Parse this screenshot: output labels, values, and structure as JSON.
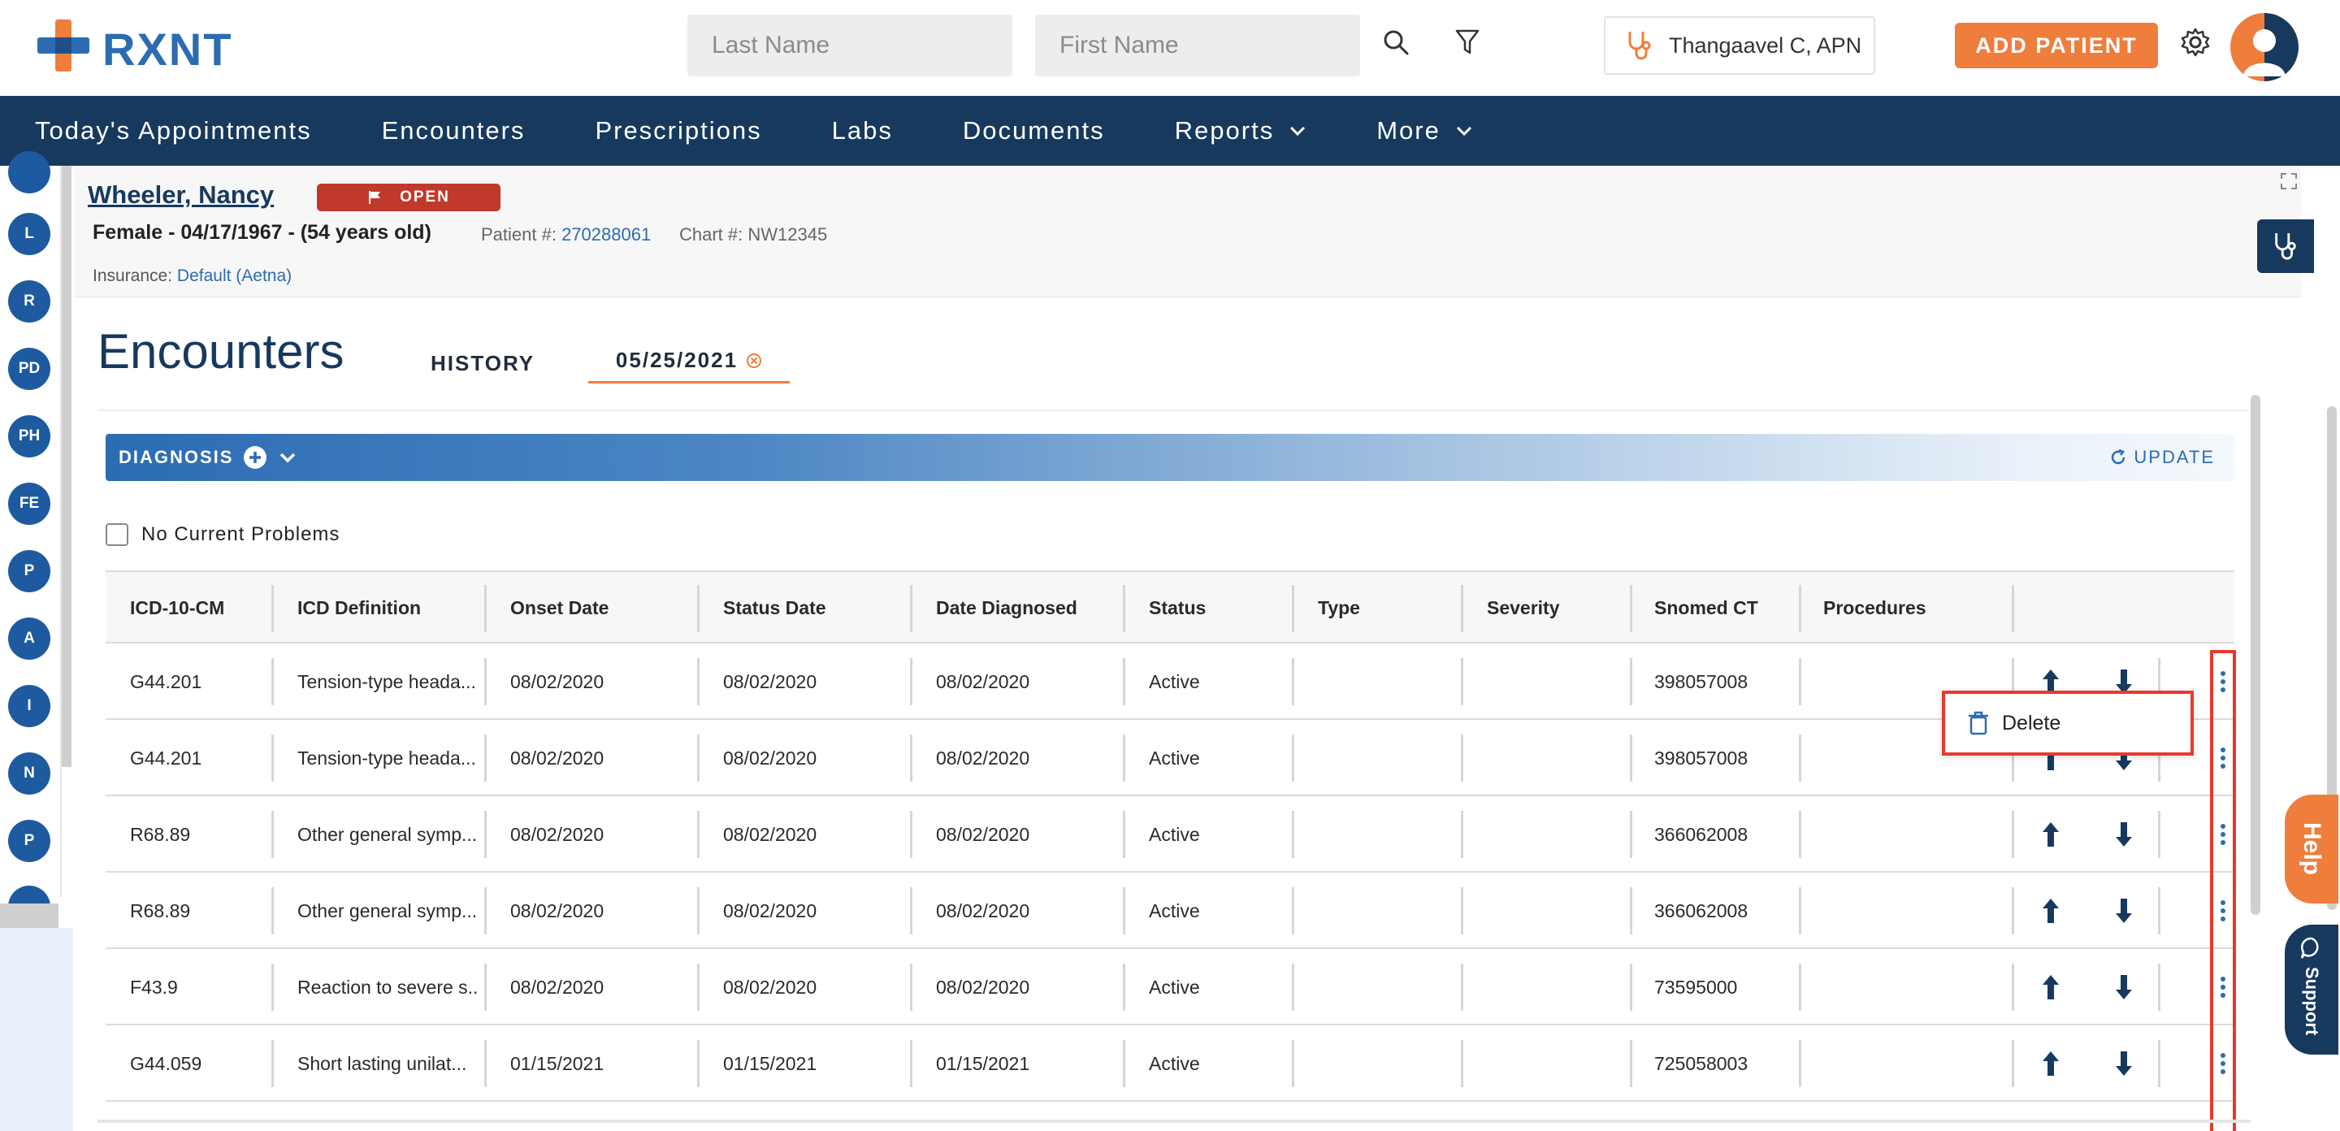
{
  "brand": {
    "logo_text": "RXNT"
  },
  "header": {
    "last_name_placeholder": "Last Name",
    "first_name_placeholder": "First Name",
    "provider_name": "Thangaavel C, APN",
    "add_patient_label": "ADD PATIENT"
  },
  "nav": {
    "items": [
      {
        "label": "Today's Appointments"
      },
      {
        "label": "Encounters"
      },
      {
        "label": "Prescriptions"
      },
      {
        "label": "Labs"
      },
      {
        "label": "Documents"
      },
      {
        "label": "Reports"
      },
      {
        "label": "More"
      }
    ]
  },
  "left_rail": {
    "items": [
      "L",
      "R",
      "PD",
      "PH",
      "FE",
      "P",
      "A",
      "I",
      "N",
      "P"
    ]
  },
  "patient": {
    "name": "Wheeler, Nancy",
    "status_badge": "OPEN",
    "demographics": "Female - 04/17/1967 - (54 years old)",
    "patient_num_label": "Patient #:",
    "patient_num": "270288061",
    "chart_label": "Chart #:",
    "chart_num": "NW12345",
    "insurance_label": "Insurance:",
    "insurance_value": "Default (Aetna)"
  },
  "encounters": {
    "title": "Encounters",
    "tab_history": "HISTORY",
    "tab_date": "05/25/2021"
  },
  "diagnosis": {
    "label": "DIAGNOSIS",
    "update_label": "UPDATE",
    "no_current_problems": "No Current Problems",
    "columns": [
      "ICD-10-CM",
      "ICD Definition",
      "Onset Date",
      "Status Date",
      "Date Diagnosed",
      "Status",
      "Type",
      "Severity",
      "Snomed CT",
      "Procedures"
    ],
    "rows": [
      {
        "icd": "G44.201",
        "def": "Tension-type heada...",
        "onset": "08/02/2020",
        "status_date": "08/02/2020",
        "diagnosed": "08/02/2020",
        "status": "Active",
        "type": "",
        "severity": "",
        "snomed": "398057008",
        "procedures": ""
      },
      {
        "icd": "G44.201",
        "def": "Tension-type heada...",
        "onset": "08/02/2020",
        "status_date": "08/02/2020",
        "diagnosed": "08/02/2020",
        "status": "Active",
        "type": "",
        "severity": "",
        "snomed": "398057008",
        "procedures": ""
      },
      {
        "icd": "R68.89",
        "def": "Other general symp...",
        "onset": "08/02/2020",
        "status_date": "08/02/2020",
        "diagnosed": "08/02/2020",
        "status": "Active",
        "type": "",
        "severity": "",
        "snomed": "366062008",
        "procedures": ""
      },
      {
        "icd": "R68.89",
        "def": "Other general symp...",
        "onset": "08/02/2020",
        "status_date": "08/02/2020",
        "diagnosed": "08/02/2020",
        "status": "Active",
        "type": "",
        "severity": "",
        "snomed": "366062008",
        "procedures": ""
      },
      {
        "icd": "F43.9",
        "def": "Reaction to severe s...",
        "onset": "08/02/2020",
        "status_date": "08/02/2020",
        "diagnosed": "08/02/2020",
        "status": "Active",
        "type": "",
        "severity": "",
        "snomed": "73595000",
        "procedures": ""
      },
      {
        "icd": "G44.059",
        "def": "Short lasting unilat...",
        "onset": "01/15/2021",
        "status_date": "01/15/2021",
        "diagnosed": "01/15/2021",
        "status": "Active",
        "type": "",
        "severity": "",
        "snomed": "725058003",
        "procedures": ""
      }
    ],
    "context_menu": {
      "delete_label": "Delete"
    }
  },
  "side_tabs": {
    "help": "Help",
    "support": "Support"
  },
  "colors": {
    "navy": "#17395e",
    "orange": "#ef7d3c",
    "blue": "#2a6cb0",
    "highlight_red": "#e53b2c",
    "badge_red": "#c0392b"
  }
}
